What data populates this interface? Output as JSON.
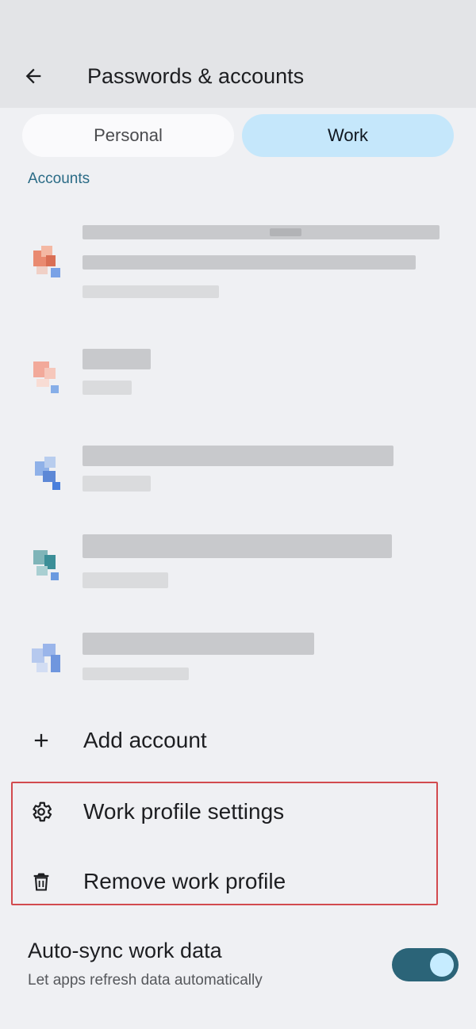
{
  "header": {
    "title": "Passwords & accounts"
  },
  "tabs": [
    {
      "label": "Personal",
      "selected": false
    },
    {
      "label": "Work",
      "selected": true
    }
  ],
  "accounts_section": {
    "label": "Accounts"
  },
  "actions": {
    "add_account": "Add account",
    "work_profile_settings": "Work profile settings",
    "remove_work_profile": "Remove work profile"
  },
  "sync": {
    "title": "Auto-sync work data",
    "subtitle": "Let apps refresh data automatically",
    "enabled": true
  },
  "colors": {
    "accent": "#2a6b86",
    "tab_selected": "#c5e7fb",
    "highlight_border": "#d24a4e",
    "toggle_track": "#2b6478"
  }
}
